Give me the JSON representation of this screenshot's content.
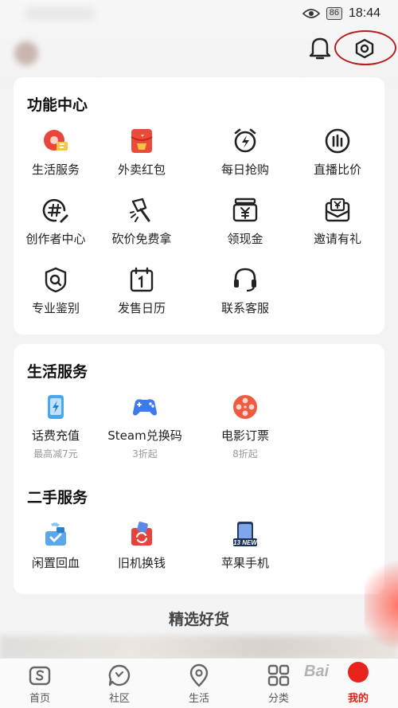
{
  "status_bar": {
    "battery": "86",
    "time": "18:44"
  },
  "header": {
    "bell_icon": "bell-icon",
    "settings_icon": "settings-hexagon-icon",
    "highlight_color": "#b32020"
  },
  "function_center": {
    "title": "功能中心",
    "items": [
      {
        "label": "生活服务",
        "icon": "life-service-icon"
      },
      {
        "label": "外卖红包",
        "icon": "red-envelope-icon"
      },
      {
        "label": "每日抢购",
        "icon": "alarm-flash-icon"
      },
      {
        "label": "直播比价",
        "icon": "live-compare-icon"
      },
      {
        "label": "创作者中心",
        "icon": "creator-hashtag-icon"
      },
      {
        "label": "砍价免费拿",
        "icon": "bargain-axe-icon"
      },
      {
        "label": "领现金",
        "icon": "cash-box-icon"
      },
      {
        "label": "邀请有礼",
        "icon": "invite-envelope-icon"
      },
      {
        "label": "专业鉴别",
        "icon": "appraisal-icon"
      },
      {
        "label": "发售日历",
        "icon": "calendar-icon"
      },
      {
        "label": "联系客服",
        "icon": "headset-icon"
      }
    ]
  },
  "life_service": {
    "title": "生活服务",
    "items": [
      {
        "label": "话费充值",
        "sub": "最高减7元",
        "icon": "phone-recharge-icon"
      },
      {
        "label": "Steam兑换码",
        "sub": "3折起",
        "icon": "gamepad-icon"
      },
      {
        "label": "电影订票",
        "sub": "8折起",
        "icon": "film-reel-icon"
      }
    ]
  },
  "second_hand": {
    "title": "二手服务",
    "items": [
      {
        "label": "闲置回血",
        "icon": "idle-box-icon"
      },
      {
        "label": "旧机换钱",
        "icon": "trade-in-icon"
      },
      {
        "label": "苹果手机",
        "icon": "iphone-icon",
        "badge": "13 NEW"
      }
    ]
  },
  "featured": {
    "title": "精选好货"
  },
  "bottom_nav": [
    {
      "label": "首页",
      "icon": "home-icon"
    },
    {
      "label": "社区",
      "icon": "community-icon"
    },
    {
      "label": "生活",
      "icon": "location-icon"
    },
    {
      "label": "分类",
      "icon": "category-grid-icon"
    },
    {
      "label": "我的",
      "icon": "profile-icon",
      "active": true
    }
  ],
  "watermark": "Bai"
}
